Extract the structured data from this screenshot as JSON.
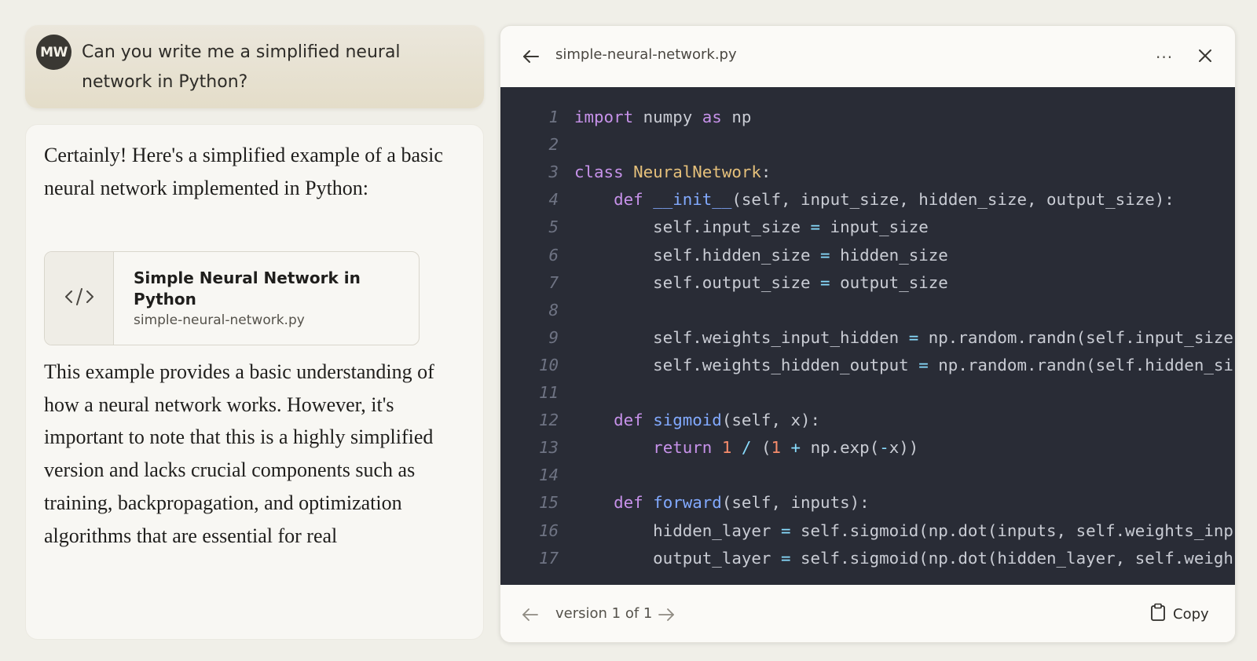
{
  "user_message": {
    "avatar_initials": "MW",
    "text": "Can you write me a simplified neural network in Python?"
  },
  "assistant_message": {
    "intro": "Certainly! Here's a simplified example of a basic neural network implemented in Python:",
    "artifact": {
      "title": "Simple Neural Network in Python",
      "filename": "simple-neural-network.py",
      "icon": "code-icon"
    },
    "body": "This example provides a basic understanding of how a neural network works. However, it's important to note that this is a highly simplified version and lacks crucial components such as training, backpropagation, and optimization algorithms that are essential for real"
  },
  "code_panel": {
    "filename": "simple-neural-network.py",
    "more_label": "···",
    "back_icon": "arrow-left-icon",
    "close_icon": "close-icon",
    "lines": [
      {
        "n": "1",
        "code": "import numpy as np"
      },
      {
        "n": "2",
        "code": ""
      },
      {
        "n": "3",
        "code": "class NeuralNetwork:"
      },
      {
        "n": "4",
        "code": "    def __init__(self, input_size, hidden_size, output_size):"
      },
      {
        "n": "5",
        "code": "        self.input_size = input_size"
      },
      {
        "n": "6",
        "code": "        self.hidden_size = hidden_size"
      },
      {
        "n": "7",
        "code": "        self.output_size = output_size"
      },
      {
        "n": "8",
        "code": ""
      },
      {
        "n": "9",
        "code": "        self.weights_input_hidden = np.random.randn(self.input_size"
      },
      {
        "n": "10",
        "code": "        self.weights_hidden_output = np.random.randn(self.hidden_si"
      },
      {
        "n": "11",
        "code": ""
      },
      {
        "n": "12",
        "code": "    def sigmoid(self, x):"
      },
      {
        "n": "13",
        "code": "        return 1 / (1 + np.exp(-x))"
      },
      {
        "n": "14",
        "code": ""
      },
      {
        "n": "15",
        "code": "    def forward(self, inputs):"
      },
      {
        "n": "16",
        "code": "        hidden_layer = self.sigmoid(np.dot(inputs, self.weights_inp"
      },
      {
        "n": "17",
        "code": "        output_layer = self.sigmoid(np.dot(hidden_layer, self.weigh"
      }
    ],
    "footer": {
      "version_label": "version 1 of 1",
      "copy_label": "Copy"
    }
  },
  "colors": {
    "background": "#f0efe8",
    "code_background": "#292c36",
    "keyword": "#c792ea",
    "class_name": "#e5c07b",
    "function": "#82aaff",
    "operator": "#89ddff",
    "number": "#f78c6c"
  }
}
